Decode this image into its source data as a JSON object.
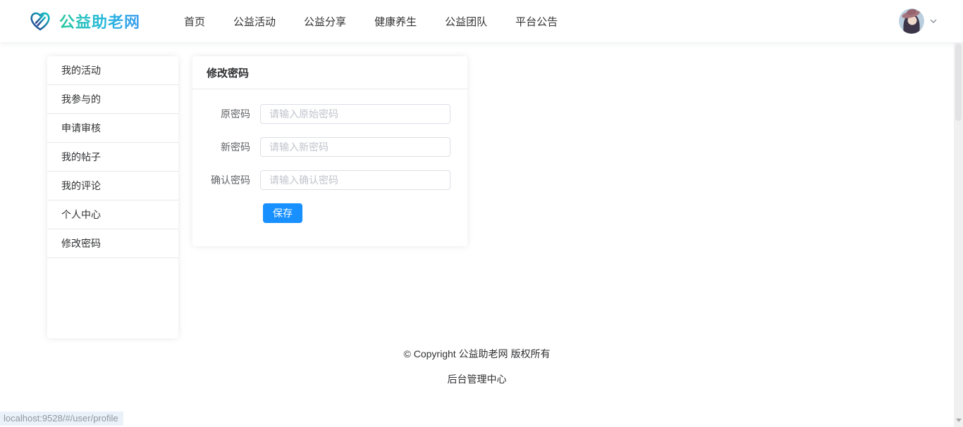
{
  "header": {
    "brand": "公益助老网",
    "nav_items": [
      {
        "label": "首页"
      },
      {
        "label": "公益活动"
      },
      {
        "label": "公益分享"
      },
      {
        "label": "健康养生"
      },
      {
        "label": "公益团队"
      },
      {
        "label": "平台公告"
      }
    ]
  },
  "sidebar": {
    "items": [
      {
        "label": "我的活动"
      },
      {
        "label": "我参与的"
      },
      {
        "label": "申请审核"
      },
      {
        "label": "我的帖子"
      },
      {
        "label": "我的评论"
      },
      {
        "label": "个人中心"
      },
      {
        "label": "修改密码"
      }
    ]
  },
  "panel": {
    "title": "修改密码",
    "fields": [
      {
        "label": "原密码",
        "placeholder": "请输入原始密码",
        "value": ""
      },
      {
        "label": "新密码",
        "placeholder": "请输入新密码",
        "value": ""
      },
      {
        "label": "确认密码",
        "placeholder": "请输入确认密码",
        "value": ""
      }
    ],
    "save_label": "保存"
  },
  "footer": {
    "copyright": "© Copyright 公益助老网 版权所有",
    "admin_center": "后台管理中心"
  },
  "statusbar": {
    "link_preview": "localhost:9528/#/user/profile"
  },
  "icons": {
    "logo": "heart-logo-icon",
    "user_menu": "chevron-down-icon",
    "scroll": "scroll-down-arrow-icon"
  },
  "colors": {
    "primary": "#1890ff",
    "brand_gradient_start": "#2bc99f",
    "brand_gradient_end": "#3f9df0"
  }
}
